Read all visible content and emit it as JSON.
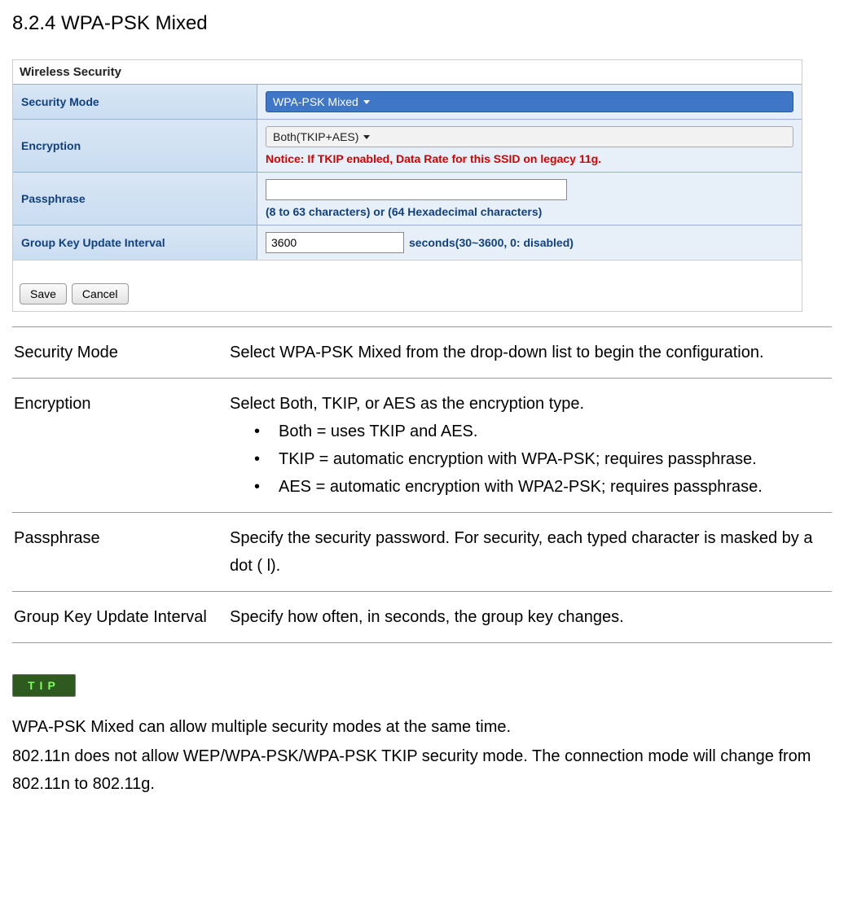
{
  "heading": "8.2.4 WPA-PSK Mixed",
  "panel": {
    "title": "Wireless Security",
    "rows": {
      "security_mode": {
        "label": "Security Mode",
        "value": "WPA-PSK Mixed"
      },
      "encryption": {
        "label": "Encryption",
        "value": "Both(TKIP+AES)",
        "notice": "Notice: If TKIP enabled, Data Rate for this SSID on legacy 11g."
      },
      "passphrase": {
        "label": "Passphrase",
        "value": "",
        "hint": "(8 to 63 characters) or (64 Hexadecimal characters)"
      },
      "group_key": {
        "label": "Group Key Update Interval",
        "value": "3600",
        "suffix": "seconds(30~3600, 0: disabled)"
      }
    },
    "buttons": {
      "save": "Save",
      "cancel": "Cancel"
    }
  },
  "descriptions": [
    {
      "term": "Security Mode",
      "text": "Select WPA-PSK Mixed from the drop-down list to begin the configuration."
    },
    {
      "term": "Encryption",
      "text": "Select Both, TKIP, or AES as the encryption type.",
      "bullets": [
        "Both = uses TKIP and AES.",
        "TKIP = automatic encryption with WPA-PSK; requires passphrase.",
        "AES = automatic encryption with WPA2-PSK; requires passphrase."
      ]
    },
    {
      "term": "Passphrase",
      "text": "Specify the security password. For security, each typed character is masked by a dot (   l)."
    },
    {
      "term": "Group Key Update Interval",
      "text": "Specify how often, in seconds, the group key changes."
    }
  ],
  "tip": {
    "badge": "TIP",
    "lines": [
      "WPA-PSK Mixed can allow multiple security modes at the same time.",
      "802.11n does not allow WEP/WPA-PSK/WPA-PSK TKIP security mode. The connection mode will change from 802.11n to 802.11g."
    ]
  }
}
